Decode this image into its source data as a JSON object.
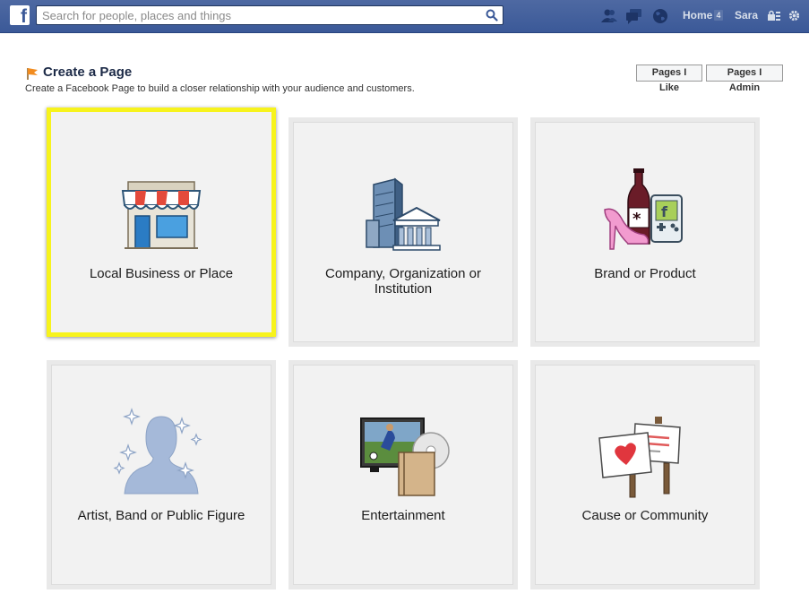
{
  "topbar": {
    "logo": "f",
    "search_placeholder": "Search for people, places and things",
    "home_label": "Home",
    "home_count": "4",
    "user_name": "Sara"
  },
  "header": {
    "title": "Create a Page",
    "subtitle": "Create a Facebook Page to build a closer relationship with your audience and customers.",
    "pages_i_like": "Pages I Like",
    "pages_i_admin": "Pages I Admin"
  },
  "tiles": [
    {
      "label": "Local Business or Place",
      "icon": "storefront-icon",
      "selected": true
    },
    {
      "label": "Company, Organization or Institution",
      "icon": "building-icon",
      "selected": false
    },
    {
      "label": "Brand or Product",
      "icon": "products-icon",
      "selected": false
    },
    {
      "label": "Artist, Band or Public Figure",
      "icon": "silhouette-icon",
      "selected": false
    },
    {
      "label": "Entertainment",
      "icon": "media-icon",
      "selected": false
    },
    {
      "label": "Cause or Community",
      "icon": "signs-icon",
      "selected": false
    }
  ],
  "colors": {
    "facebook_blue": "#3b5998",
    "highlight": "#f7f31c"
  }
}
